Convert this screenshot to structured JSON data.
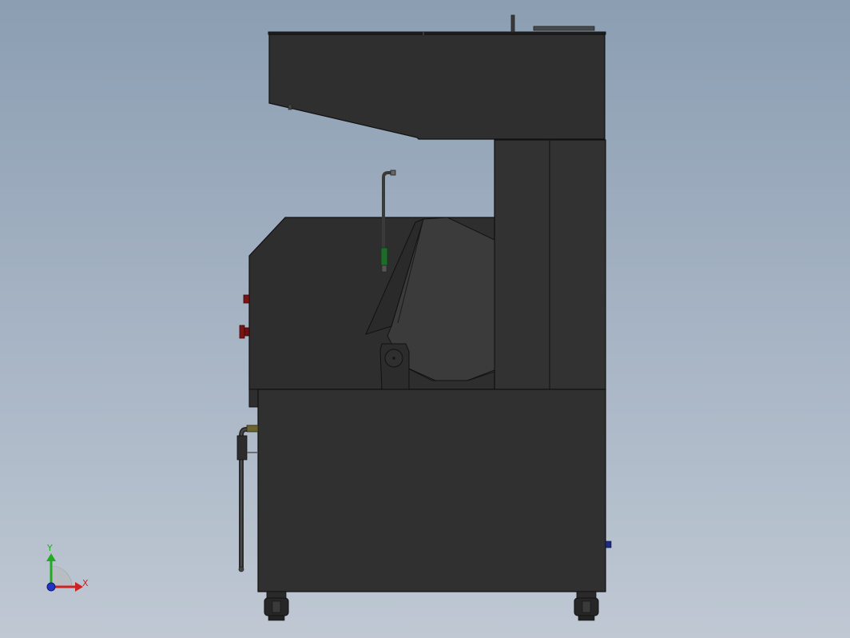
{
  "viewport": {
    "background_top": "#8b9eb2",
    "background_bottom": "#bfc8d3"
  },
  "model": {
    "body_color": "#2f2f2f",
    "edge_color": "#111111",
    "panel_color": "#333333",
    "accent_red": "#7a1414",
    "accent_green": "#1f6b2a",
    "accent_blue": "#1c2a78"
  },
  "triad": {
    "x_label": "X",
    "y_label": "Y",
    "x_color": "#cc2222",
    "y_color": "#22aa22",
    "z_color": "#2233cc"
  }
}
